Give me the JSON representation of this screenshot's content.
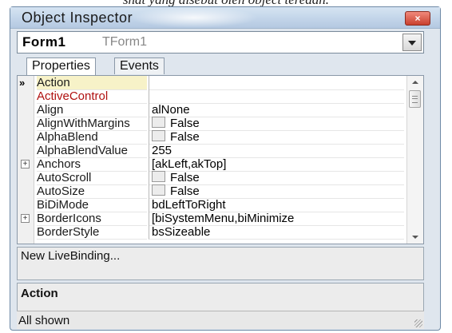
{
  "document_text": "shat yang disebut oleh object teredah.",
  "window": {
    "title": "Object Inspector",
    "close_glyph": "×"
  },
  "component_combo": {
    "name": "Form1",
    "type": "TForm1"
  },
  "tabs": [
    {
      "label": "Properties",
      "active": true
    },
    {
      "label": "Events",
      "active": false
    }
  ],
  "properties": [
    {
      "name": "Action",
      "value": "",
      "marker": "»",
      "selected": true
    },
    {
      "name": "ActiveControl",
      "value": "",
      "highlight": "red"
    },
    {
      "name": "Align",
      "value": "alNone"
    },
    {
      "name": "AlignWithMargins",
      "value": "False",
      "checkbox": true
    },
    {
      "name": "AlphaBlend",
      "value": "False",
      "checkbox": true
    },
    {
      "name": "AlphaBlendValue",
      "value": "255"
    },
    {
      "name": "Anchors",
      "value": "[akLeft,akTop]",
      "expandable": true
    },
    {
      "name": "AutoScroll",
      "value": "False",
      "checkbox": true
    },
    {
      "name": "AutoSize",
      "value": "False",
      "checkbox": true
    },
    {
      "name": "BiDiMode",
      "value": "bdLeftToRight"
    },
    {
      "name": "BorderIcons",
      "value": "[biSystemMenu,biMinimize",
      "expandable": true
    },
    {
      "name": "BorderStyle",
      "value": "bsSizeable"
    }
  ],
  "live_binding_label": "New LiveBinding...",
  "description_title": "Action",
  "status_text": "All shown"
}
